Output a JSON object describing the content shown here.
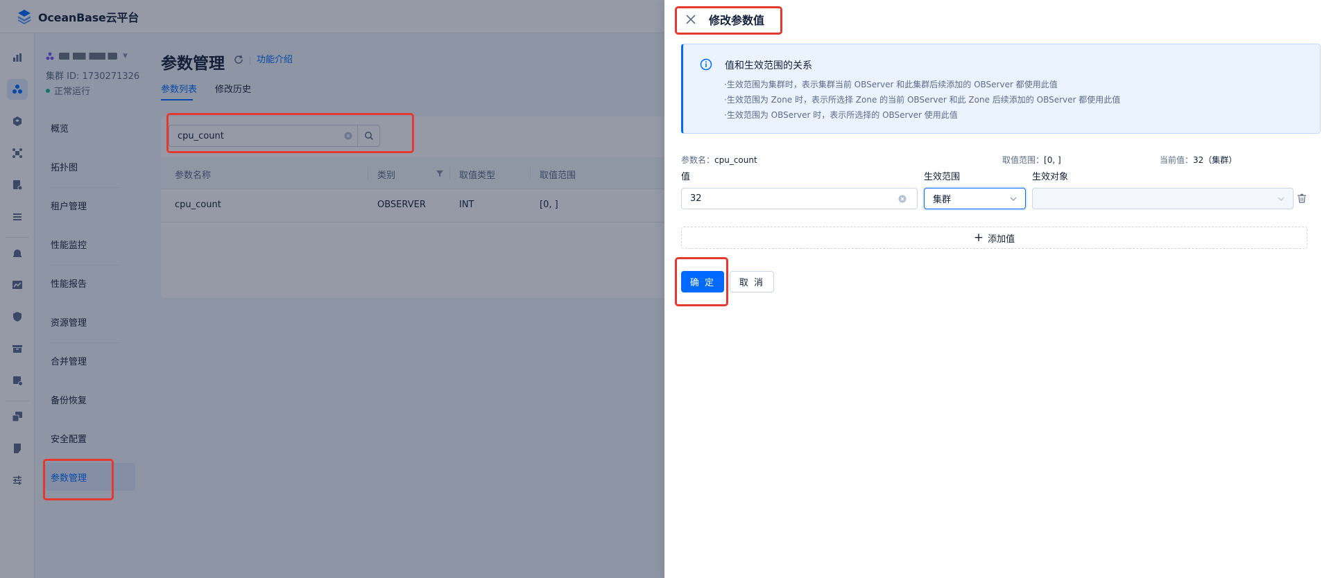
{
  "app": {
    "brand": "OceanBase云平台",
    "brand_color": "#006aff"
  },
  "rail": {
    "icons": [
      "bar-chart-icon",
      "cluster-icon",
      "cube-icon",
      "topology-icon",
      "report-icon",
      "list-icon",
      "alarm-icon",
      "trend-icon",
      "shield-icon",
      "box-icon",
      "task-icon",
      "migration-icon",
      "document-icon",
      "settings-icon"
    ]
  },
  "cluster": {
    "id_text": "集群 ID: 1730271326",
    "status": "正常运行",
    "status_color": "#0ac185"
  },
  "nav": {
    "items": [
      "概览",
      "拓扑图",
      "租户管理",
      "性能监控",
      "性能报告",
      "资源管理",
      "合并管理",
      "备份恢复",
      "安全配置",
      "参数管理"
    ],
    "active": "参数管理"
  },
  "page": {
    "title": "参数管理",
    "feature_link": "功能介绍",
    "tabs": [
      "参数列表",
      "修改历史"
    ],
    "active_tab": "参数列表"
  },
  "search": {
    "value": "cpu_count"
  },
  "table": {
    "headers": [
      "参数名称",
      "类别",
      "取值类型",
      "取值范围"
    ],
    "rows": [
      [
        "cpu_count",
        "OBSERVER",
        "INT",
        "[0, ]"
      ]
    ]
  },
  "drawer": {
    "title": "修改参数值",
    "info": {
      "title": "值和生效范围的关系",
      "lines": [
        "·生效范围为集群时，表示集群当前 OBServer 和此集群后续添加的 OBServer 都使用此值",
        "·生效范围为 Zone 时，表示所选择 Zone 的当前 OBServer 和此 Zone 后续添加的 OBServer 都使用此值",
        "·生效范围为 OBServer 时，表示所选择的 OBServer 使用此值"
      ]
    },
    "meta": {
      "param_label": "参数名：",
      "param_value": "cpu_count",
      "range_label": "取值范围：",
      "range_value": "[0, ]",
      "current_label": "当前值：",
      "current_value": "32（集群）"
    },
    "fields": {
      "value_label": "值",
      "scope_label": "生效范围",
      "target_label": "生效对象",
      "value": "32",
      "scope_selected": "集群",
      "target_selected": ""
    },
    "add_value": "添加值",
    "confirm": "确 定",
    "cancel": "取 消"
  },
  "colors": {
    "accent": "#006aff",
    "annotation": "#e5392f"
  }
}
